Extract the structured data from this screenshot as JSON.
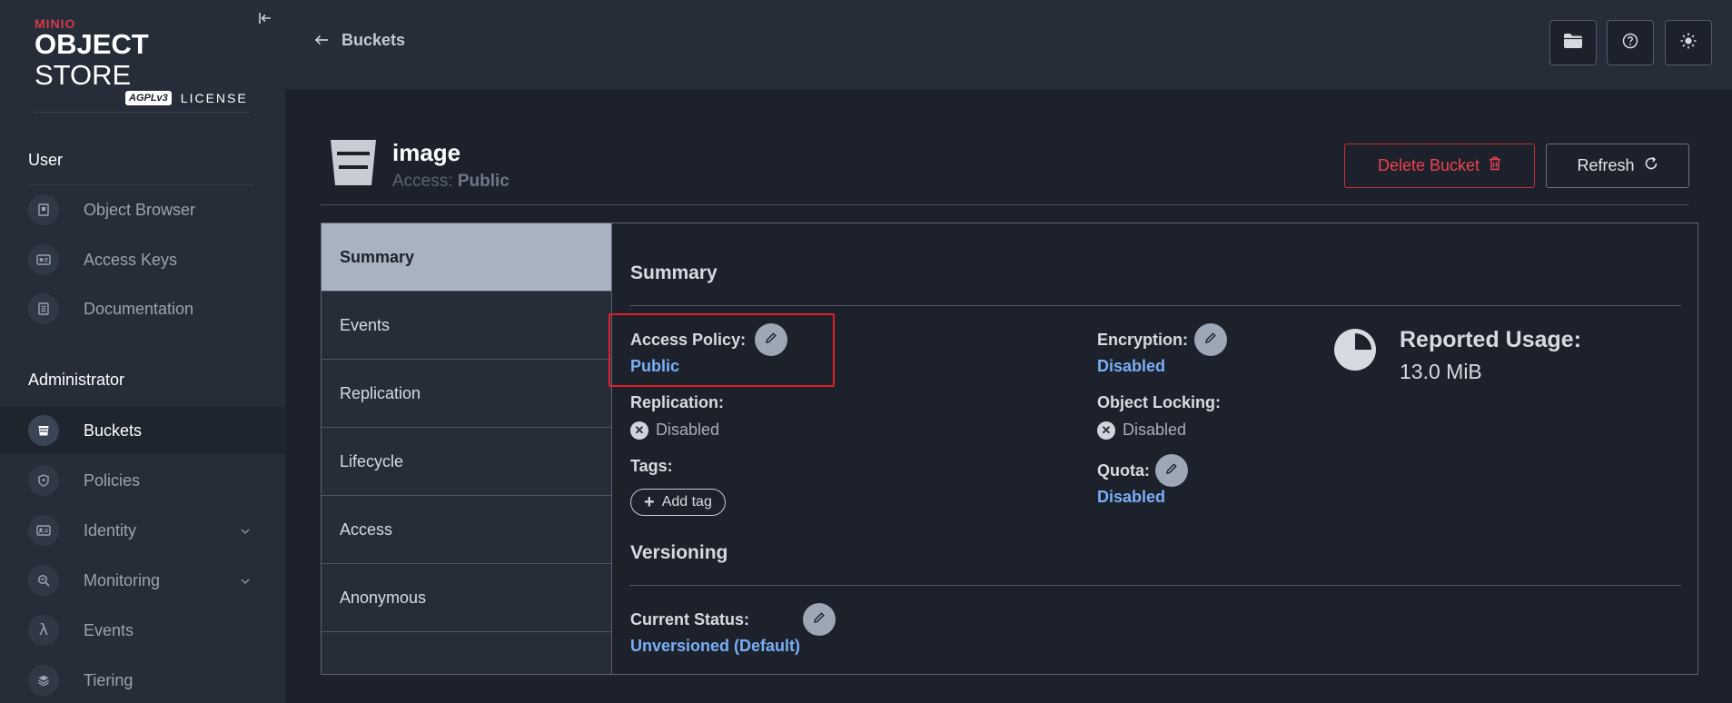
{
  "sidebar": {
    "logo": {
      "brand": "MINIO",
      "product_bold": "OBJECT",
      "product_rest": " STORE",
      "badge": "AGPLv3",
      "license": "LICENSE"
    },
    "sections": [
      {
        "title": "User"
      },
      {
        "title": "Administrator"
      }
    ],
    "items": [
      {
        "label": "Object Browser",
        "icon": "object-browser-icon"
      },
      {
        "label": "Access Keys",
        "icon": "access-keys-icon"
      },
      {
        "label": "Documentation",
        "icon": "documentation-icon"
      },
      {
        "label": "Buckets",
        "icon": "bucket-icon",
        "active": true
      },
      {
        "label": "Policies",
        "icon": "policies-icon"
      },
      {
        "label": "Identity",
        "icon": "identity-icon",
        "expandable": true
      },
      {
        "label": "Monitoring",
        "icon": "monitoring-icon",
        "expandable": true
      },
      {
        "label": "Events",
        "icon": "lambda-icon"
      },
      {
        "label": "Tiering",
        "icon": "tiering-icon"
      }
    ]
  },
  "topbar": {
    "back_label": "Buckets"
  },
  "bucket": {
    "name": "image",
    "access_prefix": "Access: ",
    "access_value": "Public",
    "delete_label": "Delete Bucket",
    "refresh_label": "Refresh"
  },
  "tabs": [
    "Summary",
    "Events",
    "Replication",
    "Lifecycle",
    "Access",
    "Anonymous"
  ],
  "summary": {
    "title": "Summary",
    "access_policy_label": "Access Policy:",
    "access_policy_value": "Public",
    "replication_label": "Replication:",
    "replication_value": "Disabled",
    "tags_label": "Tags:",
    "add_tag_label": "Add tag",
    "encryption_label": "Encryption:",
    "encryption_value": "Disabled",
    "object_locking_label": "Object Locking:",
    "object_locking_value": "Disabled",
    "quota_label": "Quota:",
    "quota_value": "Disabled",
    "usage_label": "Reported Usage:",
    "usage_value": "13.0 MiB"
  },
  "versioning": {
    "title": "Versioning",
    "status_label": "Current Status:",
    "status_value": "Unversioned (Default)"
  },
  "colors": {
    "accent_link": "#7aaef5",
    "danger": "#f0414f",
    "highlight": "#e31e2b"
  }
}
